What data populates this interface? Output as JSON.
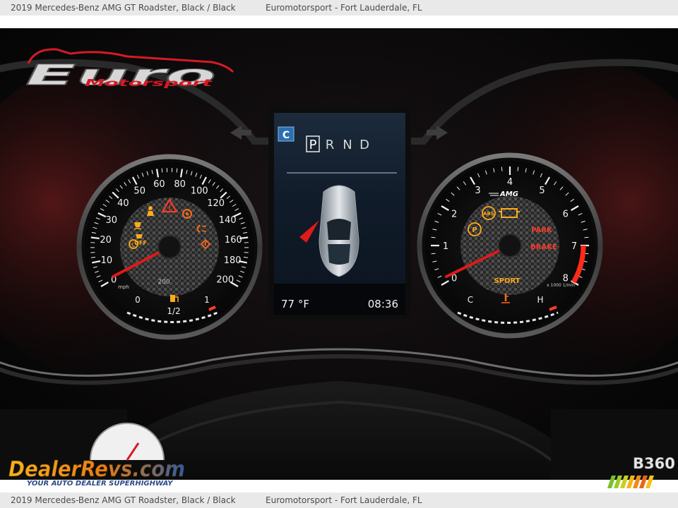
{
  "caption": {
    "vehicle": "2019 Mercedes-Benz AMG GT Roadster,  Black / Black",
    "dealer": "Euromotorsport - Fort Lauderdale, FL"
  },
  "logos": {
    "top_left": {
      "brand": "Euro",
      "sub": "Motorsport"
    },
    "bottom_left": {
      "brand": "DealerRevs.com",
      "tagline": "YOUR AUTO DEALER SUPERHIGHWAY",
      "icon": "mini-speedometer-icon"
    },
    "bottom_right": {
      "brand": "B360"
    }
  },
  "speedometer": {
    "unit": "mph",
    "ticks": [
      "0",
      "10",
      "20",
      "30",
      "40",
      "50",
      "60",
      "80",
      "100",
      "120",
      "140",
      "160",
      "180",
      "200"
    ],
    "needle_value_mph": 0,
    "odometer": "200",
    "fuel": {
      "empty": "0",
      "half": "1/2",
      "full": "1",
      "icon": "fuel-pump-icon"
    },
    "warning_icons": [
      "brake-warning-icon",
      "seatbelt-icon",
      "traction-control-icon",
      "esp-off-icon",
      "airbag-icon",
      "low-beam-icon",
      "high-beam-icon"
    ],
    "esp_off_label": "OFF"
  },
  "center_display": {
    "mode": "C",
    "gears": [
      "P",
      "R",
      "N",
      "D"
    ],
    "selected_gear": "P",
    "temperature": "77 °F",
    "time": "08:36",
    "icons": [
      "turn-left-arrow-icon",
      "turn-right-arrow-icon",
      "car-top-view-icon"
    ]
  },
  "tachometer": {
    "ticks": [
      "0",
      "1",
      "2",
      "3",
      "4",
      "5",
      "6",
      "7",
      "8"
    ],
    "brand": "AMG",
    "unit": "x 1000 1/min",
    "needle_value_rpm_x1000": 0,
    "park_label": "PARK",
    "brake_label": "BRAKE",
    "sport_label": "SPORT",
    "coolant": {
      "cold": "C",
      "hot": "H",
      "icon": "coolant-temp-icon"
    },
    "warning_icons": [
      "abs-icon",
      "check-engine-icon",
      "parking-brake-icon"
    ]
  },
  "colors": {
    "needle": "#e01919",
    "warning_amber": "#ffab1a",
    "warning_red": "#ff3b2a",
    "gauge_text": "#f2f2f2",
    "logo_red": "#d61a25"
  }
}
